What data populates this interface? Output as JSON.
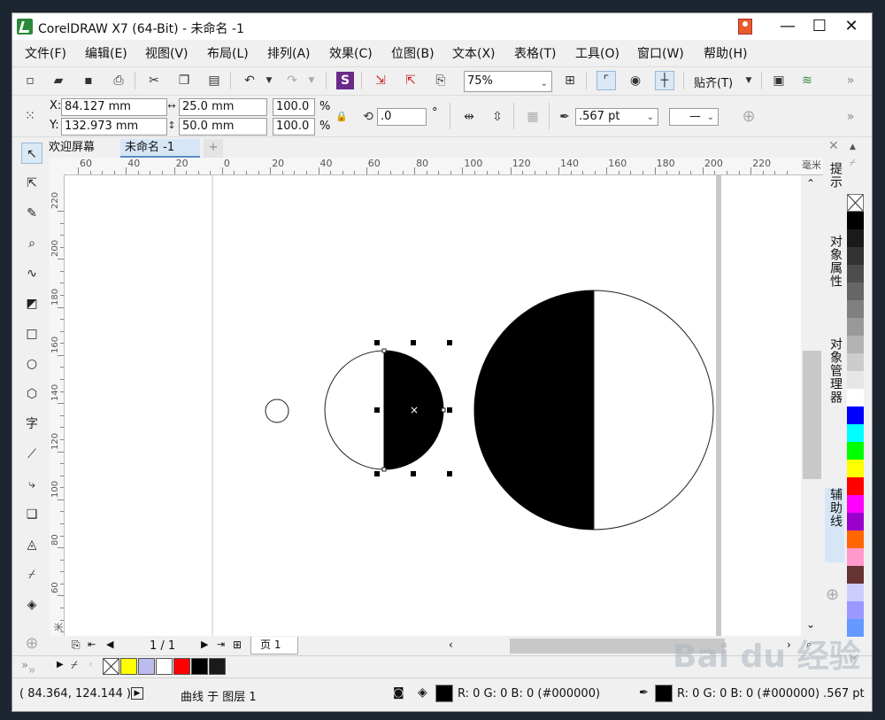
{
  "window": {
    "title": "CorelDRAW X7 (64-Bit) - 未命名 -1",
    "minimize": "—",
    "maximize": "☐",
    "close": "✕"
  },
  "menu": [
    "文件(F)",
    "编辑(E)",
    "视图(V)",
    "布局(L)",
    "排列(A)",
    "效果(C)",
    "位图(B)",
    "文本(X)",
    "表格(T)",
    "工具(O)",
    "窗口(W)",
    "帮助(H)"
  ],
  "toolbar": {
    "zoom": "75%",
    "snap_label": "贴齐(T)",
    "more": "»"
  },
  "properties": {
    "x_label": "X:",
    "x_value": "84.127 mm",
    "y_label": "Y:",
    "y_value": "132.973 mm",
    "width_value": "25.0 mm",
    "height_value": "50.0 mm",
    "scale_x": "100.0",
    "scale_y": "100.0",
    "percent": "%",
    "rotation_value": ".0",
    "degree": "°",
    "outline_width": ".567 pt",
    "line_style": "—"
  },
  "tabs": {
    "welcome": "欢迎屏幕",
    "document": "未命名 -1",
    "add": "+"
  },
  "rulers": {
    "unit": "毫米",
    "h_labels": [
      "60",
      "40",
      "20",
      "0",
      "20",
      "40",
      "60",
      "80",
      "100",
      "120",
      "140",
      "160",
      "180",
      "200",
      "220"
    ],
    "v_labels": [
      "220",
      "200",
      "180",
      "160",
      "140",
      "120",
      "100",
      "80",
      "60"
    ],
    "v_unit": "米"
  },
  "page_nav": {
    "page_counter": "1 / 1",
    "page_tab": "页 1"
  },
  "dock_tabs": [
    "提示",
    "对象属性",
    "对象管理器",
    "辅助线"
  ],
  "palette_colors": [
    "#000000",
    "#1a1a1a",
    "#333333",
    "#4d4d4d",
    "#666666",
    "#808080",
    "#999999",
    "#b3b3b3",
    "#cccccc",
    "#e6e6e6",
    "#ffffff",
    "#0000ff",
    "#00ffff",
    "#00ff00",
    "#ffff00",
    "#ff0000",
    "#ff00ff",
    "#9900cc",
    "#ff6600",
    "#ff99cc",
    "#663333",
    "#ccccff",
    "#9999ff",
    "#6699ff"
  ],
  "doc_palette_colors": [
    "#ffff00",
    "#bbbbee",
    "#ffffff",
    "#ff0000",
    "#000000",
    "#1a1a1a"
  ],
  "status": {
    "coords": "( 84.364, 124.144 )",
    "object_info": "曲线 于 图层 1",
    "fill_info": "R: 0 G: 0 B: 0 (#000000)",
    "outline_info": "R: 0 G: 0 B: 0 (#000000)  .567 pt"
  },
  "watermark": "Bai du 经验"
}
